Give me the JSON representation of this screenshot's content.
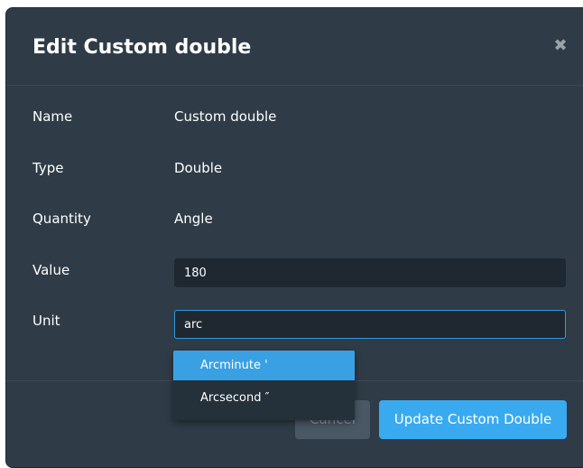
{
  "dialog": {
    "title": "Edit Custom double",
    "close_icon": "close-icon",
    "close_glyph": "✖"
  },
  "fields": {
    "name": {
      "label": "Name",
      "value": "Custom double"
    },
    "type": {
      "label": "Type",
      "value": "Double"
    },
    "quantity": {
      "label": "Quantity",
      "value": "Angle"
    },
    "value": {
      "label": "Value",
      "input_value": "180"
    },
    "unit": {
      "label": "Unit",
      "input_value": "arc"
    }
  },
  "unit_suggestions": [
    {
      "label": "Arcminute '",
      "highlighted": true
    },
    {
      "label": "Arcsecond ″",
      "highlighted": false
    }
  ],
  "footer": {
    "cancel_label": "Cancel",
    "submit_label": "Update Custom Double"
  },
  "colors": {
    "dialog_background": "#2f3c47",
    "input_background": "#1f2830",
    "focus_border": "#2f9ae0",
    "primary_button": "#3aaaf0",
    "highlight": "#3aa0e4"
  }
}
